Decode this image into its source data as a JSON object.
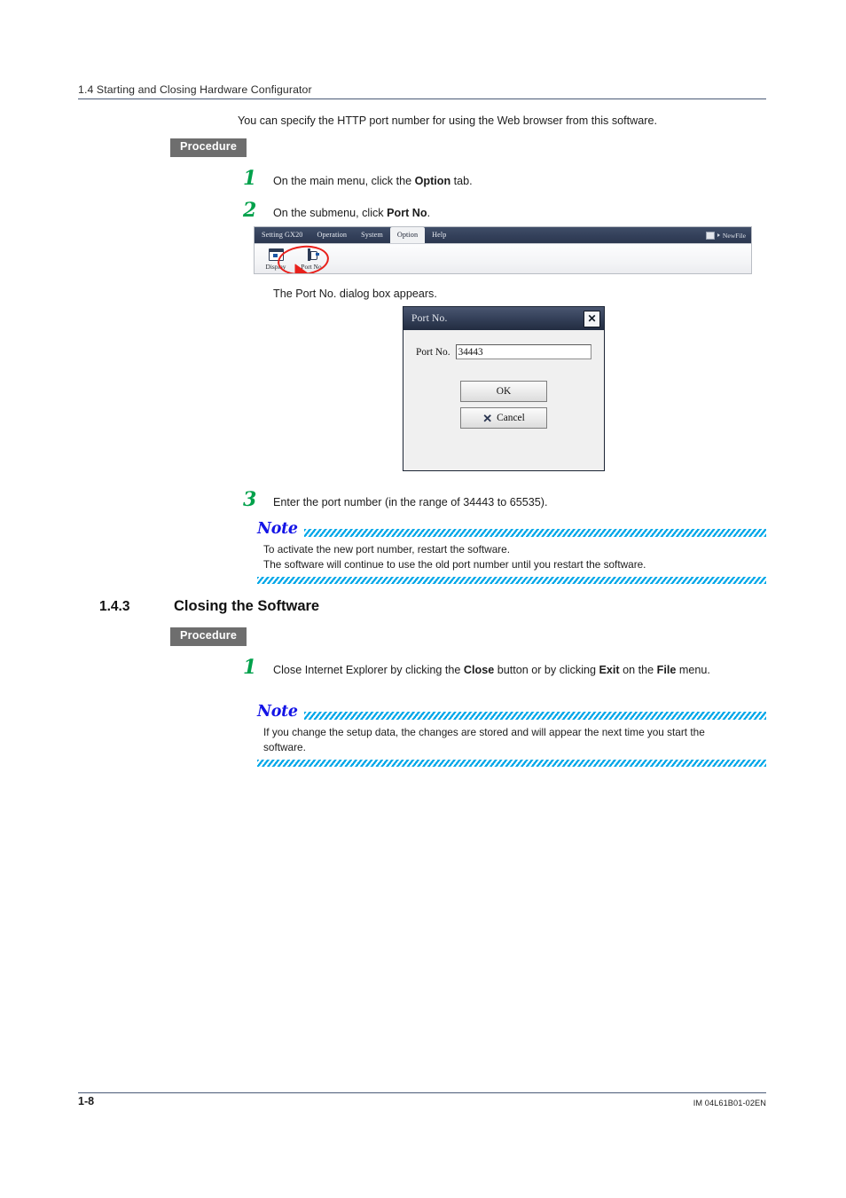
{
  "header": {
    "running_head": "1.4  Starting and Closing Hardware Configurator"
  },
  "intro": {
    "text": "You can specify the HTTP port number for using the Web browser from this software."
  },
  "procedure_badges": {
    "first": "Procedure",
    "second": "Procedure"
  },
  "steps": {
    "step1": {
      "number": "1",
      "prefix": "On the main menu, click the ",
      "bold": "Option",
      "suffix": " tab."
    },
    "step2": {
      "number": "2",
      "prefix": "On the submenu, click ",
      "bold": "Port No",
      "suffix": "."
    },
    "step3": {
      "number": "3",
      "text": "Enter the port number (in the range of 34443 to 65535)."
    },
    "step4": {
      "number": "1",
      "part1": "Close Internet Explorer by clicking the ",
      "bold1": "Close",
      "part2": " button or by clicking ",
      "bold2": "Exit",
      "part3": " on the ",
      "bold3": "File",
      "part4": " menu."
    }
  },
  "caption": {
    "dialog_appears": "The Port No. dialog box appears."
  },
  "app_screenshot": {
    "menu_tabs": [
      {
        "label": "Setting GX20",
        "active": false
      },
      {
        "label": "Operation",
        "active": false
      },
      {
        "label": "System",
        "active": false
      },
      {
        "label": "Option",
        "active": true
      },
      {
        "label": "Help",
        "active": false
      }
    ],
    "file_status": "NewFile",
    "ribbon_buttons": [
      {
        "label": "Display",
        "icon": "display-window-icon"
      },
      {
        "label": "Port No",
        "icon": "port-connector-icon"
      }
    ],
    "annotation_color": "#e8201b"
  },
  "dialog": {
    "title": "Port No.",
    "close_glyph": "✕",
    "field_label": "Port No.",
    "field_value": "34443",
    "field_placeholder": "",
    "ok_label": "OK",
    "cancel_label": "Cancel",
    "cancel_icon_glyph": "✕"
  },
  "notes": {
    "note1": {
      "word": "Note",
      "line1": "To activate the new port number, restart the software.",
      "line2": "The software will continue to use the old port number until you restart the software."
    },
    "note2": {
      "word": "Note",
      "line1": "If you change the setup data, the changes are stored and will appear the next time you start the",
      "line2": "software."
    }
  },
  "section": {
    "number": "1.4.3",
    "title": "Closing the Software"
  },
  "footer": {
    "page_number": "1-8",
    "document_code": "IM 04L61B01-02EN"
  },
  "colors": {
    "accent_green": "#00a14b",
    "note_blue": "#1414e6",
    "hatch_cyan": "#00a7e8",
    "badge_gray": "#6e6e6e",
    "rule_navy": "#4a5a77"
  }
}
